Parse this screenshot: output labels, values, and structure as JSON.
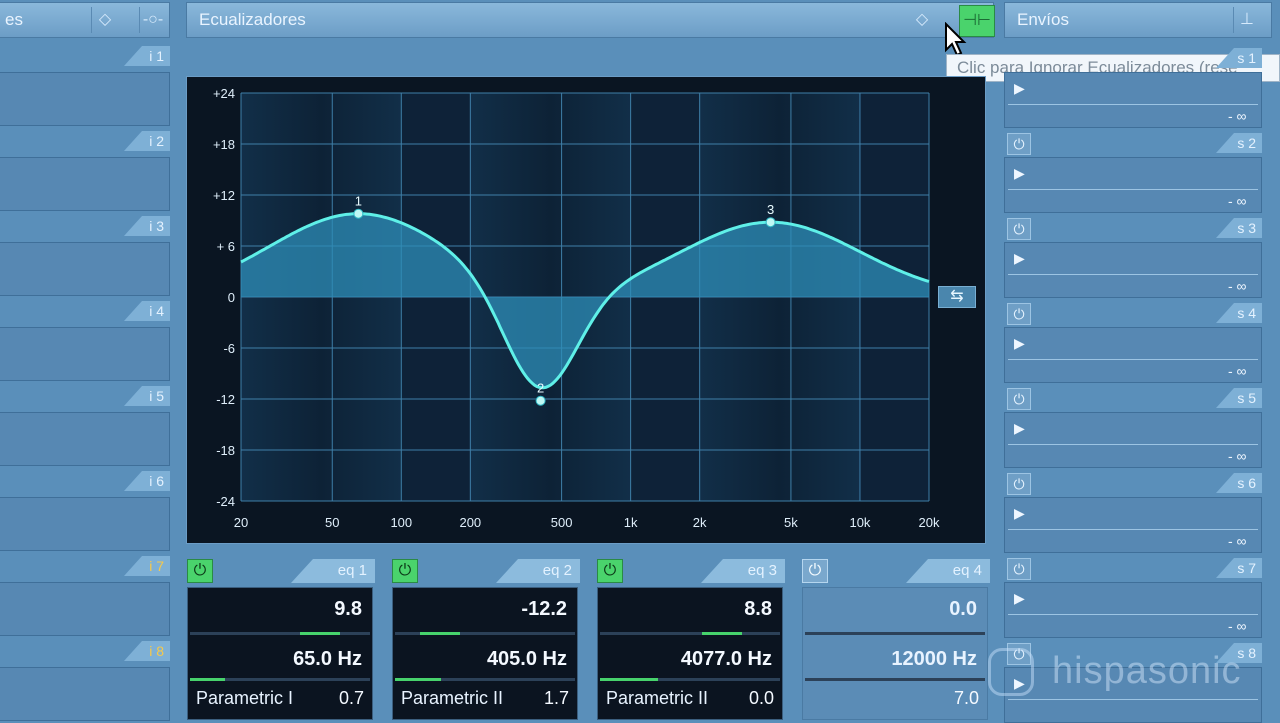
{
  "headers": {
    "left_partial": "es",
    "eq_title": "Ecualizadores",
    "sends_title": "Envíos"
  },
  "tooltip": "Clic para Ignorar Ecualizadores (rese",
  "inserts": [
    {
      "label": "i 1",
      "highlight": false
    },
    {
      "label": "i 2",
      "highlight": false
    },
    {
      "label": "i 3",
      "highlight": false
    },
    {
      "label": "i 4",
      "highlight": false
    },
    {
      "label": "i 5",
      "highlight": false
    },
    {
      "label": "i 6",
      "highlight": false
    },
    {
      "label": "i 7",
      "highlight": true
    },
    {
      "label": "i 8",
      "highlight": true
    }
  ],
  "sends": [
    {
      "label": "s 1",
      "value": "- ∞"
    },
    {
      "label": "s 2",
      "value": "- ∞"
    },
    {
      "label": "s 3",
      "value": "- ∞"
    },
    {
      "label": "s 4",
      "value": "- ∞"
    },
    {
      "label": "s 5",
      "value": "- ∞"
    },
    {
      "label": "s 6",
      "value": "- ∞"
    },
    {
      "label": "s 7",
      "value": "- ∞"
    },
    {
      "label": "s 8",
      "value": ""
    }
  ],
  "graph": {
    "db_ticks": [
      "+24",
      "+18",
      "+12",
      "+ 6",
      "0",
      "-6",
      "-12",
      "-18",
      "-24"
    ],
    "freq_ticks": [
      "20",
      "50",
      "100",
      "200",
      "500",
      "1k",
      "2k",
      "5k",
      "10k",
      "20k"
    ],
    "curve_color": "#5ff0e8",
    "fill_color": "#2e8db8",
    "bands": [
      {
        "id": "1",
        "freq_hz": 65,
        "gain_db": 9.8
      },
      {
        "id": "2",
        "freq_hz": 405,
        "gain_db": -12.2
      },
      {
        "id": "3",
        "freq_hz": 4077,
        "gain_db": 8.8
      }
    ]
  },
  "eq_modules": [
    {
      "tab": "eq 1",
      "on": true,
      "gain": "9.8",
      "gain_level": 0.72,
      "freq": "65.0 Hz",
      "freq_level": 0.15,
      "type": "Parametric I",
      "q": "0.7"
    },
    {
      "tab": "eq 2",
      "on": true,
      "gain": "-12.2",
      "gain_level": 0.25,
      "freq": "405.0 Hz",
      "freq_level": 0.45,
      "type": "Parametric II",
      "q": "1.7"
    },
    {
      "tab": "eq 3",
      "on": true,
      "gain": "8.8",
      "gain_level": 0.68,
      "freq": "4077.0 Hz",
      "freq_level": 0.78,
      "type": "Parametric II",
      "q": "0.0"
    },
    {
      "tab": "eq 4",
      "on": false,
      "gain": "0.0",
      "gain_level": 0.5,
      "freq": "12000 Hz",
      "freq_level": 0.9,
      "type": "",
      "q": "7.0"
    }
  ],
  "watermark": "hispasonic",
  "colors": {
    "accent_green": "#47d36c",
    "panel_blue": "#5a8fba"
  }
}
